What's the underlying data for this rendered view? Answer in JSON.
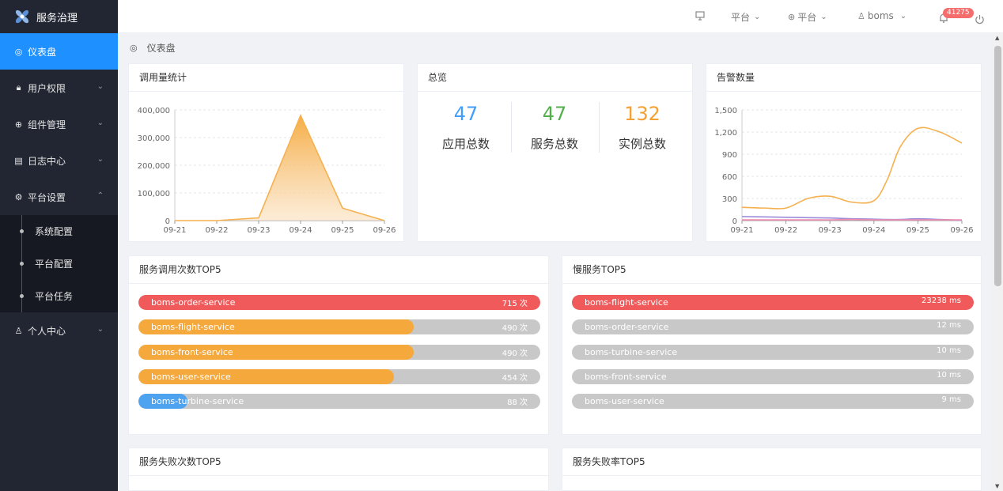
{
  "app": {
    "title": "服务治理"
  },
  "sidebar": {
    "items": [
      {
        "label": "仪表盘",
        "icon": "dashboard-icon"
      },
      {
        "label": "用户权限",
        "icon": "lock-icon"
      },
      {
        "label": "组件管理",
        "icon": "globe-icon"
      },
      {
        "label": "日志中心",
        "icon": "document-icon"
      },
      {
        "label": "平台设置",
        "icon": "gear-icon"
      },
      {
        "label": "个人中心",
        "icon": "user-icon"
      }
    ],
    "submenu": [
      "系统配置",
      "平台配置",
      "平台任务"
    ]
  },
  "header": {
    "platform1": "平台",
    "platform2": "平台",
    "user": "boms",
    "notifications": "41275"
  },
  "breadcrumb": "仪表盘",
  "cards": {
    "calls_title": "调用量统计",
    "overview_title": "总览",
    "alerts_title": "告警数量",
    "top_calls_title": "服务调用次数TOP5",
    "slow_title": "慢服务TOP5",
    "fail_count_title": "服务失败次数TOP5",
    "fail_rate_title": "服务失败率TOP5"
  },
  "overview": {
    "apps": {
      "value": "47",
      "label": "应用总数",
      "color": "#409eff"
    },
    "services": {
      "value": "47",
      "label": "服务总数",
      "color": "#52b04a"
    },
    "instances": {
      "value": "132",
      "label": "实例总数",
      "color": "#f5a033"
    }
  },
  "top_calls": [
    {
      "name": "boms-order-service",
      "value": "715 次",
      "ratio": 1.0,
      "color": "#f05a5a"
    },
    {
      "name": "boms-flight-service",
      "value": "490 次",
      "ratio": 0.685,
      "color": "#f5a93c"
    },
    {
      "name": "boms-front-service",
      "value": "490 次",
      "ratio": 0.685,
      "color": "#f5a93c"
    },
    {
      "name": "boms-user-service",
      "value": "454 次",
      "ratio": 0.635,
      "color": "#f5a93c"
    },
    {
      "name": "boms-turbine-service",
      "value": "88 次",
      "ratio": 0.123,
      "color": "#4da3f0"
    }
  ],
  "slow_services": [
    {
      "name": "boms-flight-service",
      "value": "23238 ms",
      "ratio": 1.0,
      "color": "#f05a5a"
    },
    {
      "name": "boms-order-service",
      "value": "12 ms",
      "ratio": 0.0,
      "color": "#f05a5a"
    },
    {
      "name": "boms-turbine-service",
      "value": "10 ms",
      "ratio": 0.0,
      "color": "#f05a5a"
    },
    {
      "name": "boms-front-service",
      "value": "10 ms",
      "ratio": 0.0,
      "color": "#f05a5a"
    },
    {
      "name": "boms-user-service",
      "value": "9 ms",
      "ratio": 0.0,
      "color": "#f05a5a"
    }
  ],
  "chart_data": [
    {
      "type": "area",
      "categories": [
        "09-21",
        "09-22",
        "09-23",
        "09-24",
        "09-25",
        "09-26"
      ],
      "series": [
        {
          "values": [
            0,
            0,
            10000,
            380000,
            45000,
            0
          ]
        }
      ],
      "ylim": [
        0,
        400000
      ],
      "yticks": [
        "0",
        "100,000",
        "200,000",
        "300,000",
        "400,000"
      ],
      "color": "#f5b14f",
      "grid": true
    },
    {
      "type": "line",
      "categories": [
        "09-21",
        "09-22",
        "09-23",
        "09-24",
        "09-25",
        "09-26"
      ],
      "x": [
        0,
        0.5,
        1,
        1.5,
        2,
        2.5,
        3,
        3.3,
        3.6,
        4,
        4.5,
        5
      ],
      "series": [
        {
          "values": [
            180,
            170,
            170,
            300,
            330,
            250,
            270,
            550,
            1000,
            1250,
            1200,
            1050
          ],
          "color": "#f5b14f"
        },
        {
          "values": [
            55,
            50,
            45,
            40,
            35,
            25,
            20,
            15,
            15,
            25,
            15,
            5
          ],
          "color": "#9b8bd9"
        },
        {
          "values": [
            10,
            10,
            10,
            10,
            10,
            15,
            10,
            10,
            10,
            10,
            10,
            10
          ],
          "color": "#f08cb0"
        }
      ],
      "ylim": [
        0,
        1500
      ],
      "yticks": [
        "0",
        "300",
        "600",
        "900",
        "1,200",
        "1,500"
      ],
      "grid": true
    }
  ]
}
